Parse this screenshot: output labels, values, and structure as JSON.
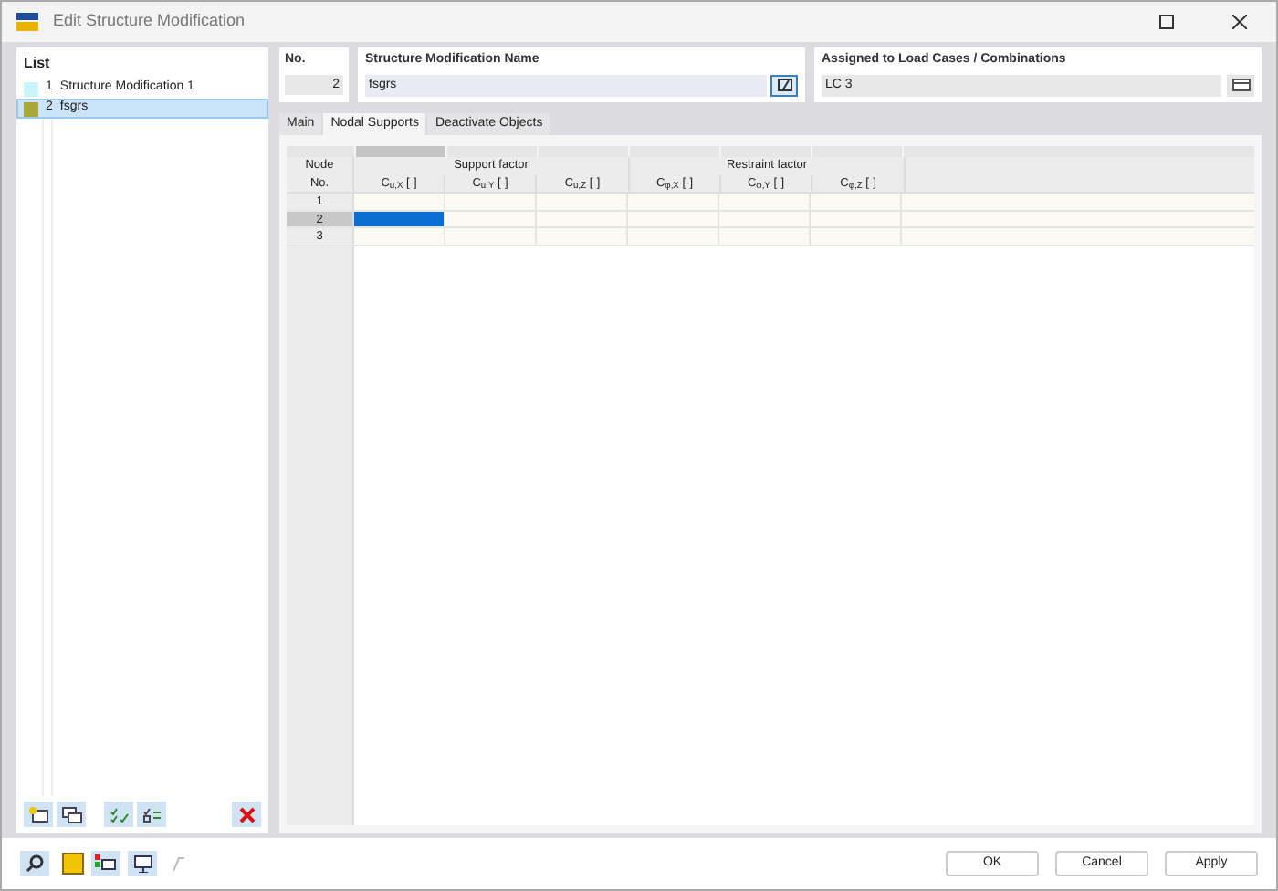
{
  "window": {
    "title": "Edit Structure Modification"
  },
  "list": {
    "title": "List",
    "items": [
      {
        "number": "1",
        "name": "Structure Modification 1",
        "color": "#c8f4f8",
        "selected": false
      },
      {
        "number": "2",
        "name": "fsgrs",
        "color": "#a8a838",
        "selected": true
      }
    ]
  },
  "number_field": {
    "label": "No.",
    "value": "2"
  },
  "name_field": {
    "label": "Structure Modification Name",
    "value": "fsgrs"
  },
  "assigned_field": {
    "label": "Assigned to Load Cases / Combinations",
    "value": "LC 3"
  },
  "tabs": [
    {
      "label": "Main",
      "selected": false
    },
    {
      "label": "Nodal Supports",
      "selected": true
    },
    {
      "label": "Deactivate Objects",
      "selected": false
    }
  ],
  "table": {
    "corner_header": [
      "Node",
      "No."
    ],
    "groups": [
      {
        "label": "Support factor",
        "columns": [
          "C$_{u,X}$ [-]",
          "C$_{u,Y}$ [-]",
          "C$_{u,Z}$ [-]"
        ]
      },
      {
        "label": "Restraint factor",
        "columns": [
          "C$_{φ,X}$ [-]",
          "C$_{φ,Y}$ [-]",
          "C$_{φ,Z}$ [-]"
        ]
      }
    ],
    "rows": [
      {
        "label": "1",
        "selected": false
      },
      {
        "label": "2",
        "selected": true
      },
      {
        "label": "3",
        "selected": false
      }
    ]
  },
  "buttons": [
    "OK",
    "Cancel",
    "Apply"
  ]
}
